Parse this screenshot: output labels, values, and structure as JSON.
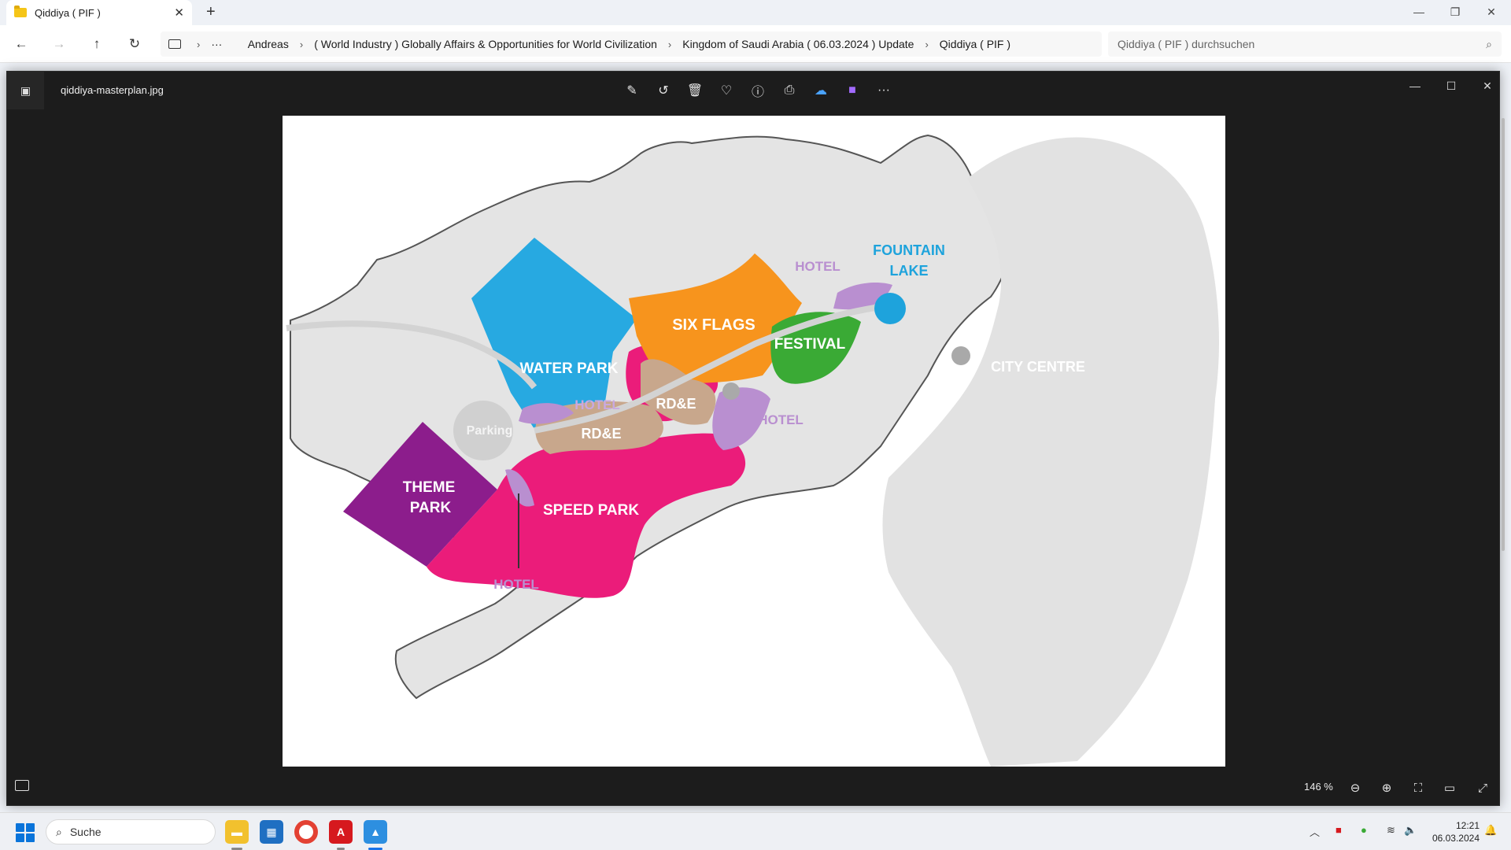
{
  "explorer": {
    "tab_title": "Qiddiya ( PIF )",
    "breadcrumbs": [
      "Andreas",
      "( World Industry ) Globally Affairs & Opportunities for World Civilization",
      "Kingdom of Saudi Arabia ( 06.03.2024 ) Update",
      "Qiddiya ( PIF )"
    ],
    "search_placeholder": "Qiddiya ( PIF ) durchsuchen"
  },
  "viewer": {
    "filename": "qiddiya-masterplan.jpg",
    "zoom": "146 %",
    "map_labels": {
      "six_flags": "SIX FLAGS",
      "festival": "FESTIVAL",
      "water_park": "WATER PARK",
      "theme_park_1": "THEME",
      "theme_park_2": "PARK",
      "speed_park": "SPEED PARK",
      "hotel_top": "HOTEL",
      "hotel_mid": "HOTEL",
      "hotel_right": "HOTEL",
      "hotel_bottom": "HOTEL",
      "rdge_1": "RD&E",
      "rdge_2": "RD&E",
      "parking": "Parking",
      "fountain_1": "FOUNTAIN",
      "fountain_2": "LAKE",
      "city_centre": "CITY CENTRE"
    }
  },
  "taskbar": {
    "search_label": "Suche",
    "time": "12:21",
    "date": "06.03.2024"
  },
  "colors": {
    "six_flags": "#f7941d",
    "festival": "#3aaa35",
    "water_park": "#27a9e1",
    "theme_park": "#8c1d8c",
    "speed_park": "#eb1c7a",
    "hotel": "#b98fd0",
    "rdge": "#c8a78c",
    "fountain": "#1ea3dc",
    "terrain": "#e2e2e2"
  }
}
